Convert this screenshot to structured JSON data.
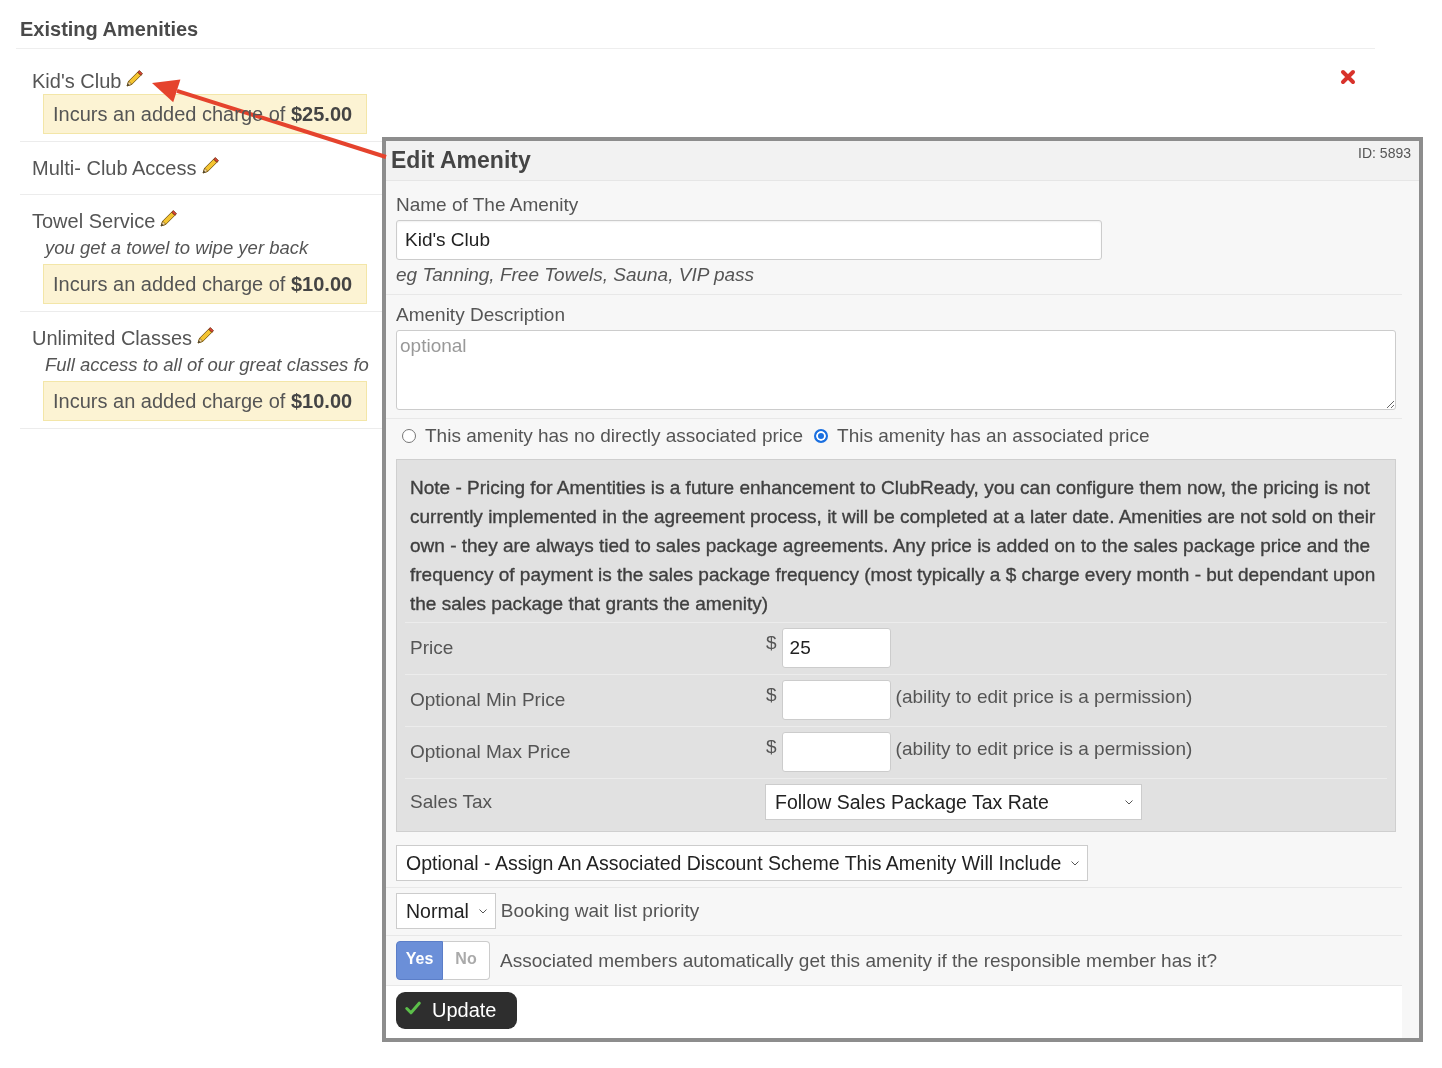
{
  "existing_amenities": {
    "title": "Existing Amenities",
    "items": [
      {
        "name": "Kid's Club",
        "charge": "Incurs an added charge of **$25.00**",
        "deletable": true
      },
      {
        "name": "Multi- Club Access"
      },
      {
        "name": "Towel Service",
        "description": "you get a towel to wipe yer back",
        "charge": "Incurs an added charge of **$10.00**"
      },
      {
        "name": "Unlimited Classes",
        "description": "Full access to all of our great classes fo",
        "charge": "Incurs an added charge of **$10.00**"
      }
    ]
  },
  "edit_amenity_dialog": {
    "title": "Edit Amenity",
    "id_label": "ID: 5893",
    "name_field": {
      "label": "Name of The Amenity",
      "value": "Kid's Club",
      "hint": "eg Tanning, Free Towels, Sauna, VIP pass"
    },
    "description_field": {
      "label": "Amenity Description",
      "placeholder": "optional"
    },
    "price_options": [
      {
        "label": "This amenity has no directly associated price",
        "selected": false
      },
      {
        "label": "This amenity has an associated price",
        "selected": true
      }
    ],
    "pricing_panel": {
      "note": "Note - Pricing for Amentities is a future enhancement to ClubReady, you can configure them now, the pricing is not currently implemented in the agreement process, it will be completed at a later date. Amenities are not sold on their own - they are always tied to sales package agreements. Any price is added on to the sales package price and the frequency of payment is the sales package frequency (most typically a $ charge every month - but dependant upon the sales package that grants the amenity)",
      "rows": [
        {
          "kind": "money",
          "label": "Price",
          "currency": "$",
          "value": "25"
        },
        {
          "kind": "money",
          "label": "Optional Min Price",
          "currency": "$",
          "hint": "(ability to edit price is a permission)"
        },
        {
          "kind": "money",
          "label": "Optional Max Price",
          "currency": "$",
          "hint": "(ability to edit price is a permission)"
        },
        {
          "kind": "select",
          "label": "Sales Tax",
          "value": "Follow Sales Package Tax Rate"
        }
      ]
    },
    "discount_scheme_select": {
      "value": "Optional - Assign An Associated Discount Scheme This Amenity Will Include"
    },
    "wait_list_priority": {
      "value": "Normal",
      "label": "Booking wait list priority"
    },
    "associated_members": {
      "options": [
        {
          "label": "Yes",
          "selected": true
        },
        {
          "label": "No",
          "selected": false
        }
      ],
      "label": "Associated members automatically get this amenity if the responsible member has it?"
    },
    "update_button": {
      "label": "Update"
    }
  }
}
